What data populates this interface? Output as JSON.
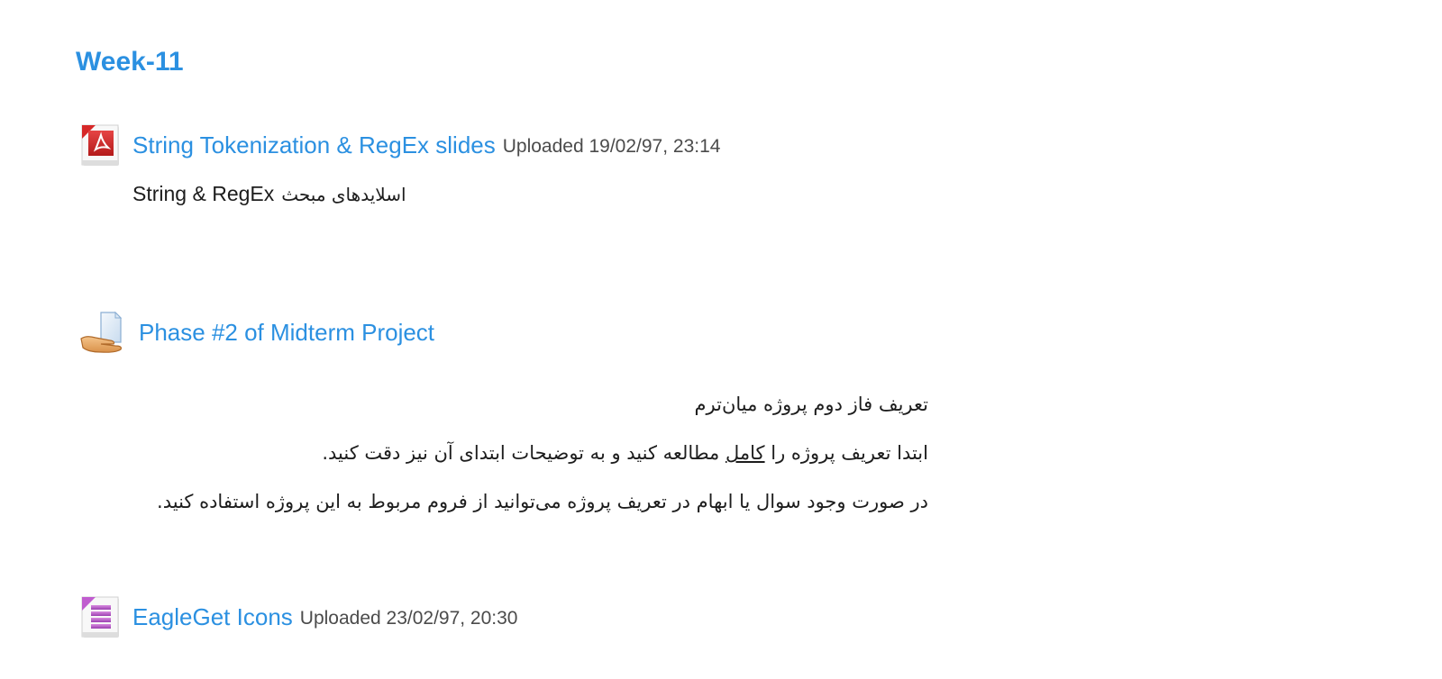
{
  "section": {
    "title": "Week-11"
  },
  "activities": [
    {
      "icon": "pdf-icon",
      "name": "String Tokenization & RegEx slides",
      "details": "Uploaded 19/02/97, 23:14",
      "description_ltr": "String & RegEx",
      "description_rtl": "اسلایدهای مبحث"
    },
    {
      "icon": "assignment-icon",
      "name": "Phase #2 of Midterm Project",
      "description_lines": [
        "تعریف فاز دوم پروژه میان‌ترم",
        "ابتدا تعریف پروژه را",
        "کامل",
        "مطالعه کنید و به توضیحات ابتدای آن نیز دقت کنید.",
        "در صورت وجود سوال یا ابهام در تعریف پروژه می‌توانید از فروم مربوط به این پروژه استفاده کنید."
      ]
    },
    {
      "icon": "archive-icon",
      "name": "EagleGet Icons",
      "details": "Uploaded 23/02/97, 20:30"
    }
  ],
  "colors": {
    "link": "#2b90e1",
    "text": "#1d1d1d",
    "details": "#4b4b4b"
  }
}
